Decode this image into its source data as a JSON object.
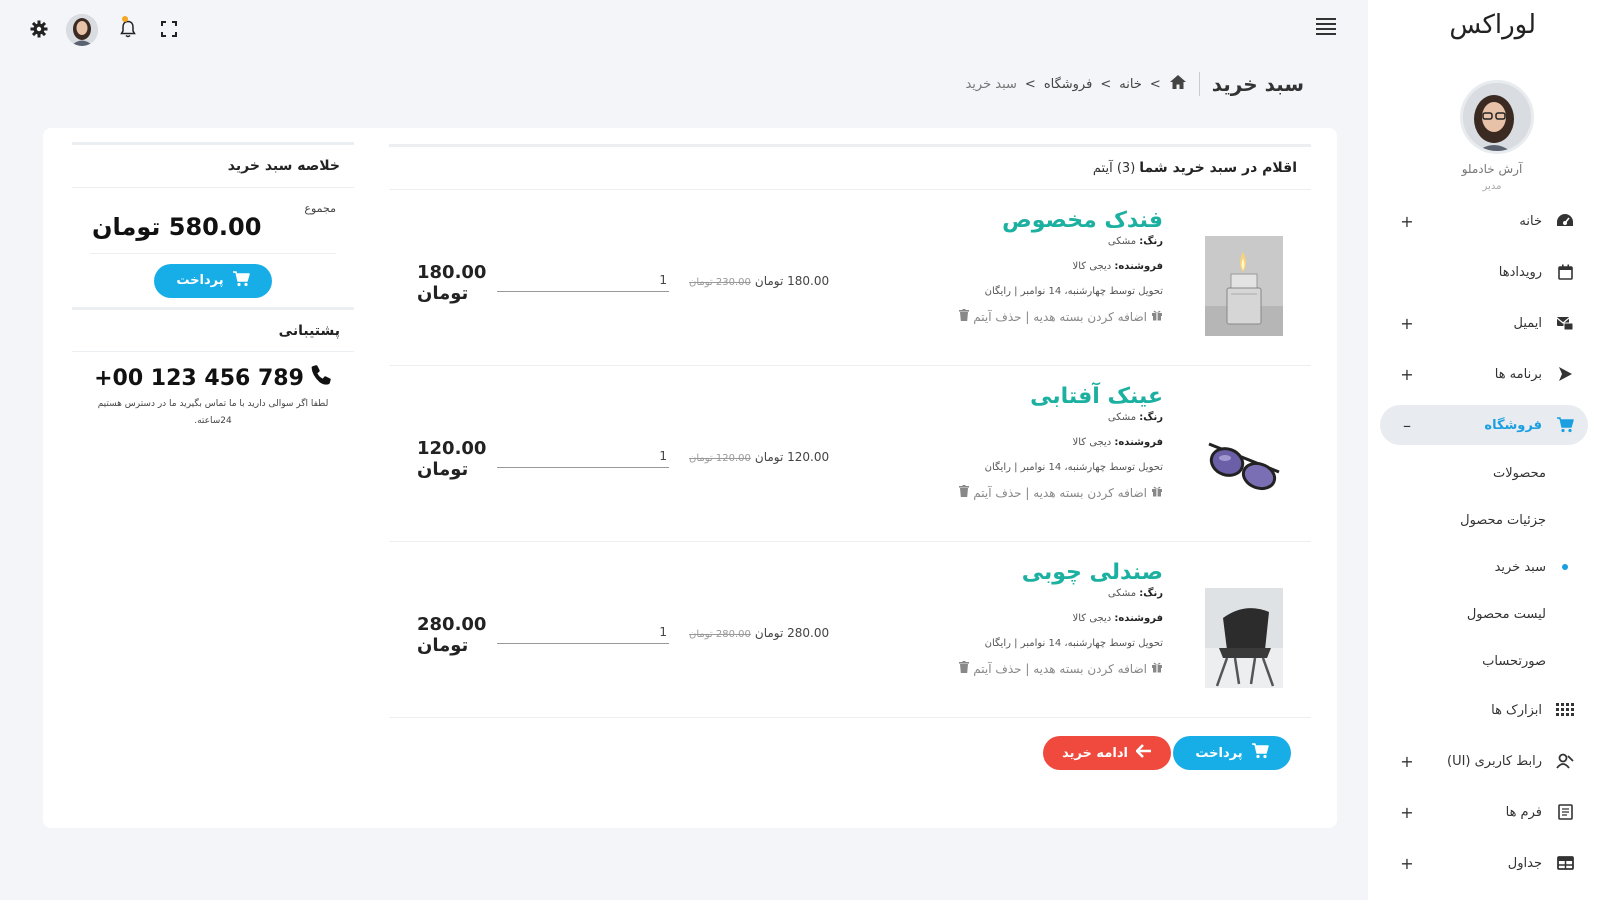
{
  "sidebar": {
    "brand": "لوراکس",
    "profile": {
      "name": "آرش خادملو",
      "role": "مدیر"
    },
    "items": [
      {
        "label": "خانه",
        "icon": "dashboard-icon",
        "toggle": "+"
      },
      {
        "label": "رویدادها",
        "icon": "calendar-icon",
        "toggle": ""
      },
      {
        "label": "ایمیل",
        "icon": "mail-icon",
        "toggle": "+"
      },
      {
        "label": "برنامه ها",
        "icon": "apps-icon",
        "toggle": "+"
      },
      {
        "label": "فروشگاه",
        "icon": "cart-icon",
        "toggle": "–"
      },
      {
        "label": "ابزارک ها",
        "icon": "widgets-icon",
        "toggle": ""
      },
      {
        "label": "رابط کاربری (UI)",
        "icon": "ui-icon",
        "toggle": "+"
      },
      {
        "label": "فرم ها",
        "icon": "forms-icon",
        "toggle": "+"
      },
      {
        "label": "جداول",
        "icon": "tables-icon",
        "toggle": "+"
      }
    ],
    "sub_items": [
      "محصولات",
      "جزئیات محصول",
      "سبد خرید",
      "لیست محصول",
      "صورتحساب"
    ]
  },
  "header": {
    "page_title": "سبد خرید",
    "breadcrumb": [
      "خانه",
      "فروشگاه",
      "سبد خرید"
    ],
    "breadcrumb_sep": ">"
  },
  "cart": {
    "title": "اقلام در سبد خرید شما",
    "count": "(3) آیتم",
    "color_label": "رنگ:",
    "seller_label": "فروشنده:",
    "items": [
      {
        "name": "فندک مخصوص",
        "color": "مشکی",
        "seller": "دیجی کالا",
        "delivery": "تحویل توسط چهارشنبه، 14 نوامبر | رایگان",
        "actions": "اضافه کردن بسته هدیه | حذف آیتم",
        "price": "180.00 تومان",
        "old_price": "230.00 تومان",
        "qty": "1",
        "total": "180.00",
        "total_unit": "تومان"
      },
      {
        "name": "عینک آفتابی",
        "color": "مشکی",
        "seller": "دیجی کالا",
        "delivery": "تحویل توسط چهارشنبه، 14 نوامبر | رایگان",
        "actions": "اضافه کردن بسته هدیه | حذف آیتم",
        "price": "120.00 تومان",
        "old_price": "120.00 تومان",
        "qty": "1",
        "total": "120.00",
        "total_unit": "تومان"
      },
      {
        "name": "صندلی چوبی",
        "color": "مشکی",
        "seller": "دیجی کالا",
        "delivery": "تحویل توسط چهارشنبه، 14 نوامبر | رایگان",
        "actions": "اضافه کردن بسته هدیه | حذف آیتم",
        "price": "280.00 تومان",
        "old_price": "280.00 تومان",
        "qty": "1",
        "total": "280.00",
        "total_unit": "تومان"
      }
    ],
    "pay_label": "پرداخت",
    "continue_label": "ادامه خرید"
  },
  "summary": {
    "title": "خلاصه سبد خرید",
    "total_label": "مجموع",
    "total": "580.00 تومان",
    "pay_label": "پرداخت",
    "support_title": "پشتیبانی",
    "phone": "+00 123 456 789",
    "support_note": "لطفا اگر سوالی دارید با ما تماس بگیرید ما در دسترس هستیم 24ساعته."
  },
  "colors": {
    "accent": "#17aee8",
    "product_name": "#1cb0a0",
    "danger": "#f04a3e"
  }
}
